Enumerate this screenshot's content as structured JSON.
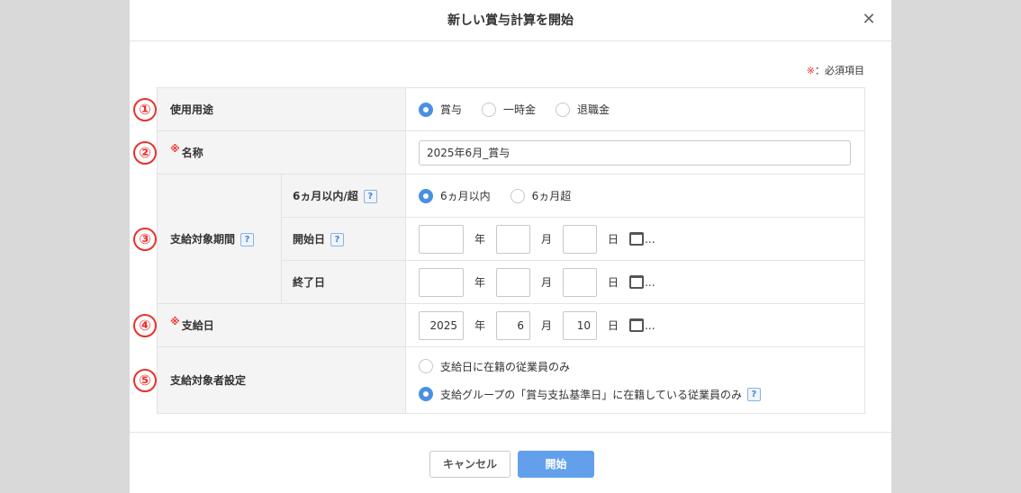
{
  "modal": {
    "title": "新しい賞与計算を開始",
    "close_glyph": "✕"
  },
  "required_note": {
    "mark": "※",
    "text": "：必須項目"
  },
  "rows": {
    "usage": {
      "badge": "①",
      "label": "使用用途",
      "options": [
        "賞与",
        "一時金",
        "退職金"
      ],
      "selected": "賞与"
    },
    "name": {
      "badge": "②",
      "required_mark": "※",
      "label": "名称",
      "value": "2025年6月_賞与"
    },
    "period": {
      "badge": "③",
      "label": "支給対象期間",
      "help": "?",
      "within_label": "6ヵ月以内/超",
      "within_options": [
        "6ヵ月以内",
        "6ヵ月超"
      ],
      "within_selected": "6ヵ月以内",
      "start_label": "開始日",
      "end_label": "終了日"
    },
    "payday": {
      "badge": "④",
      "required_mark": "※",
      "label": "支給日",
      "year": "2025",
      "month": "6",
      "day": "10"
    },
    "target": {
      "badge": "⑤",
      "label": "支給対象者設定",
      "options": [
        "支給日に在籍の従業員のみ",
        "支給グループの「賞与支払基準日」に在籍している従業員のみ"
      ],
      "selected_index": 1
    }
  },
  "date_units": {
    "year": "年",
    "month": "月",
    "day": "日",
    "more": "..."
  },
  "help_glyph": "?",
  "buttons": {
    "cancel": "キャンセル",
    "start": "開始"
  },
  "colors": {
    "accent": "#4a90e2",
    "required": "#e8322c",
    "primary_button": "#62a0ec"
  }
}
